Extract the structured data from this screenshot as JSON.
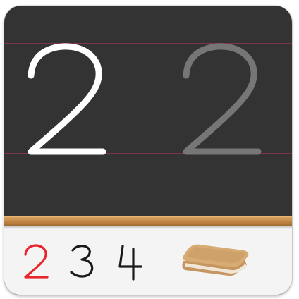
{
  "board": {
    "practice_digit": "2",
    "model_digit": "2",
    "chalk_color": "#ffffff",
    "ghost_color": "#767676",
    "board_color": "#333334",
    "guide_line_color": "#7a3548"
  },
  "tray": {
    "digits": [
      {
        "label": "2",
        "selected": true,
        "color": "#e8262b"
      },
      {
        "label": "3",
        "selected": false,
        "color": "#1a1a1a"
      },
      {
        "label": "4",
        "selected": false,
        "color": "#1a1a1a"
      }
    ],
    "eraser_icon": "eraser-icon"
  }
}
